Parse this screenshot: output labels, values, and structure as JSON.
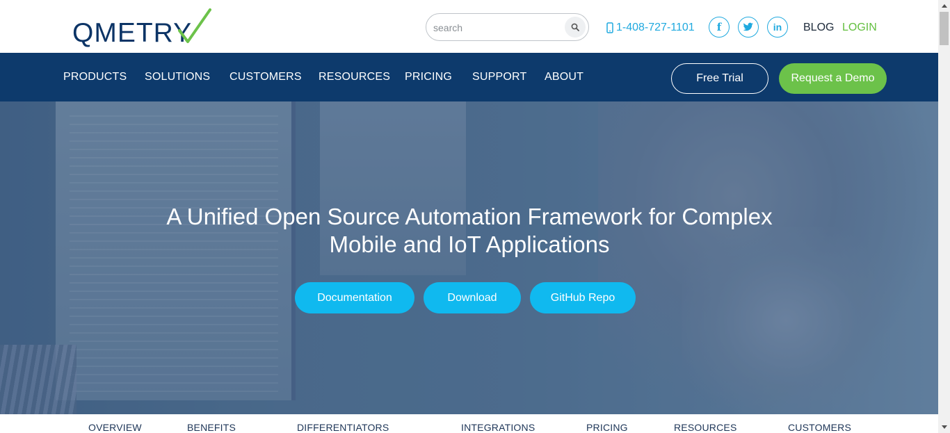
{
  "header": {
    "logo_text": "QMETRY",
    "search_placeholder": "search",
    "phone": "1-408-727-1101",
    "social": {
      "facebook": "f",
      "twitter": "t",
      "linkedin": "in"
    },
    "blog": "BLOG",
    "login": "LOGIN"
  },
  "nav": {
    "items": [
      "PRODUCTS",
      "SOLUTIONS",
      "CUSTOMERS",
      "RESOURCES",
      "PRICING",
      "SUPPORT",
      "ABOUT"
    ],
    "free_trial": "Free Trial",
    "request_demo": "Request a Demo"
  },
  "hero": {
    "title_line1": "A Unified Open Source Automation Framework for Complex",
    "title_line2": "Mobile and IoT Applications",
    "buttons": {
      "documentation": "Documentation",
      "download": "Download",
      "github": "GitHub Repo"
    }
  },
  "subnav": {
    "items": [
      "OVERVIEW",
      "BENEFITS",
      "DIFFERENTIATORS",
      "INTEGRATIONS",
      "PRICING",
      "RESOURCES",
      "CUSTOMERS"
    ]
  },
  "colors": {
    "brand_navy": "#0d3a6c",
    "brand_green": "#6cc24a",
    "accent_cyan": "#10b9ef",
    "link_blue": "#1fa9df"
  }
}
